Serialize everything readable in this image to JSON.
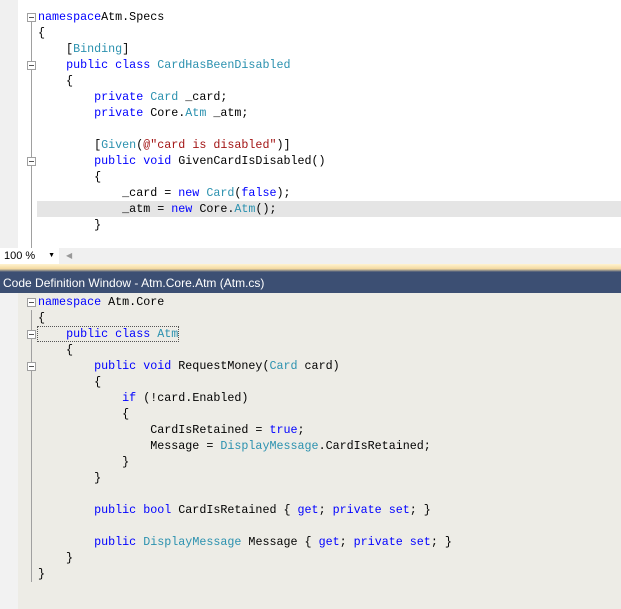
{
  "editor": {
    "lines": [
      [
        [
          "kw",
          "namespace"
        ],
        [
          "",
          "Atm.Specs"
        ]
      ],
      [
        [
          "",
          "{"
        ]
      ],
      [
        [
          "",
          "    ["
        ],
        [
          "ty",
          "Binding"
        ],
        [
          "",
          "]"
        ]
      ],
      [
        [
          "",
          "    "
        ],
        [
          "kw",
          "public class "
        ],
        [
          "ty",
          "CardHasBeenDisabled"
        ]
      ],
      [
        [
          "",
          "    {"
        ]
      ],
      [
        [
          "",
          "        "
        ],
        [
          "kw",
          "private "
        ],
        [
          "ty",
          "Card"
        ],
        [
          "",
          " _card;"
        ]
      ],
      [
        [
          "",
          "        "
        ],
        [
          "kw",
          "private "
        ],
        [
          "",
          "Core."
        ],
        [
          "ty",
          "Atm"
        ],
        [
          "",
          " _atm;"
        ]
      ],
      [
        [
          "",
          ""
        ]
      ],
      [
        [
          "",
          "        ["
        ],
        [
          "ty",
          "Given"
        ],
        [
          "",
          "("
        ],
        [
          "st",
          "@\"card is disabled\""
        ],
        [
          "",
          ")]"
        ]
      ],
      [
        [
          "",
          "        "
        ],
        [
          "kw",
          "public void "
        ],
        [
          "",
          "GivenCardIsDisabled()"
        ]
      ],
      [
        [
          "",
          "        {"
        ]
      ],
      [
        [
          "",
          "            _card = "
        ],
        [
          "kw",
          "new "
        ],
        [
          "ty",
          "Card"
        ],
        [
          "",
          "("
        ],
        [
          "kw",
          "false"
        ],
        [
          "",
          ");"
        ]
      ],
      [
        [
          "",
          "            _atm = "
        ],
        [
          "kw",
          "new "
        ],
        [
          "",
          "Core."
        ],
        [
          "ty",
          "Atm"
        ],
        [
          "",
          "();"
        ]
      ],
      [
        [
          "",
          "        }"
        ]
      ]
    ]
  },
  "status": {
    "zoom": "100 %"
  },
  "definition_window": {
    "title": "Code Definition Window - Atm.Core.Atm (Atm.cs)",
    "lines": [
      [
        [
          "kw",
          "namespace"
        ],
        [
          "",
          " Atm.Core"
        ]
      ],
      [
        [
          "",
          "{"
        ]
      ],
      [
        [
          "",
          "    "
        ],
        [
          "kw",
          "public class "
        ],
        [
          "ty",
          "Atm"
        ]
      ],
      [
        [
          "",
          "    {"
        ]
      ],
      [
        [
          "",
          "        "
        ],
        [
          "kw",
          "public void "
        ],
        [
          "",
          "RequestMoney("
        ],
        [
          "ty",
          "Card"
        ],
        [
          "",
          " card)"
        ]
      ],
      [
        [
          "",
          "        {"
        ]
      ],
      [
        [
          "",
          "            "
        ],
        [
          "kw",
          "if "
        ],
        [
          "",
          "(!card.Enabled)"
        ]
      ],
      [
        [
          "",
          "            {"
        ]
      ],
      [
        [
          "",
          "                CardIsRetained = "
        ],
        [
          "kw",
          "true"
        ],
        [
          "",
          ";"
        ]
      ],
      [
        [
          "",
          "                Message = "
        ],
        [
          "ty",
          "DisplayMessage"
        ],
        [
          "",
          ".CardIsRetained;"
        ]
      ],
      [
        [
          "",
          "            }"
        ]
      ],
      [
        [
          "",
          "        }"
        ]
      ],
      [
        [
          "",
          ""
        ]
      ],
      [
        [
          "",
          "        "
        ],
        [
          "kw",
          "public bool "
        ],
        [
          "",
          "CardIsRetained { "
        ],
        [
          "kw",
          "get"
        ],
        [
          "",
          "; "
        ],
        [
          "kw",
          "private set"
        ],
        [
          "",
          "; }"
        ]
      ],
      [
        [
          "",
          ""
        ]
      ],
      [
        [
          "",
          "        "
        ],
        [
          "kw",
          "public "
        ],
        [
          "ty",
          "DisplayMessage"
        ],
        [
          "",
          " Message { "
        ],
        [
          "kw",
          "get"
        ],
        [
          "",
          "; "
        ],
        [
          "kw",
          "private set"
        ],
        [
          "",
          "; }"
        ]
      ],
      [
        [
          "",
          "    }"
        ]
      ],
      [
        [
          "",
          "}"
        ]
      ]
    ]
  },
  "colors": {
    "keyword": "#0000ff",
    "type": "#2b91af",
    "string": "#a31515",
    "titlebar": "#3c4f73"
  }
}
